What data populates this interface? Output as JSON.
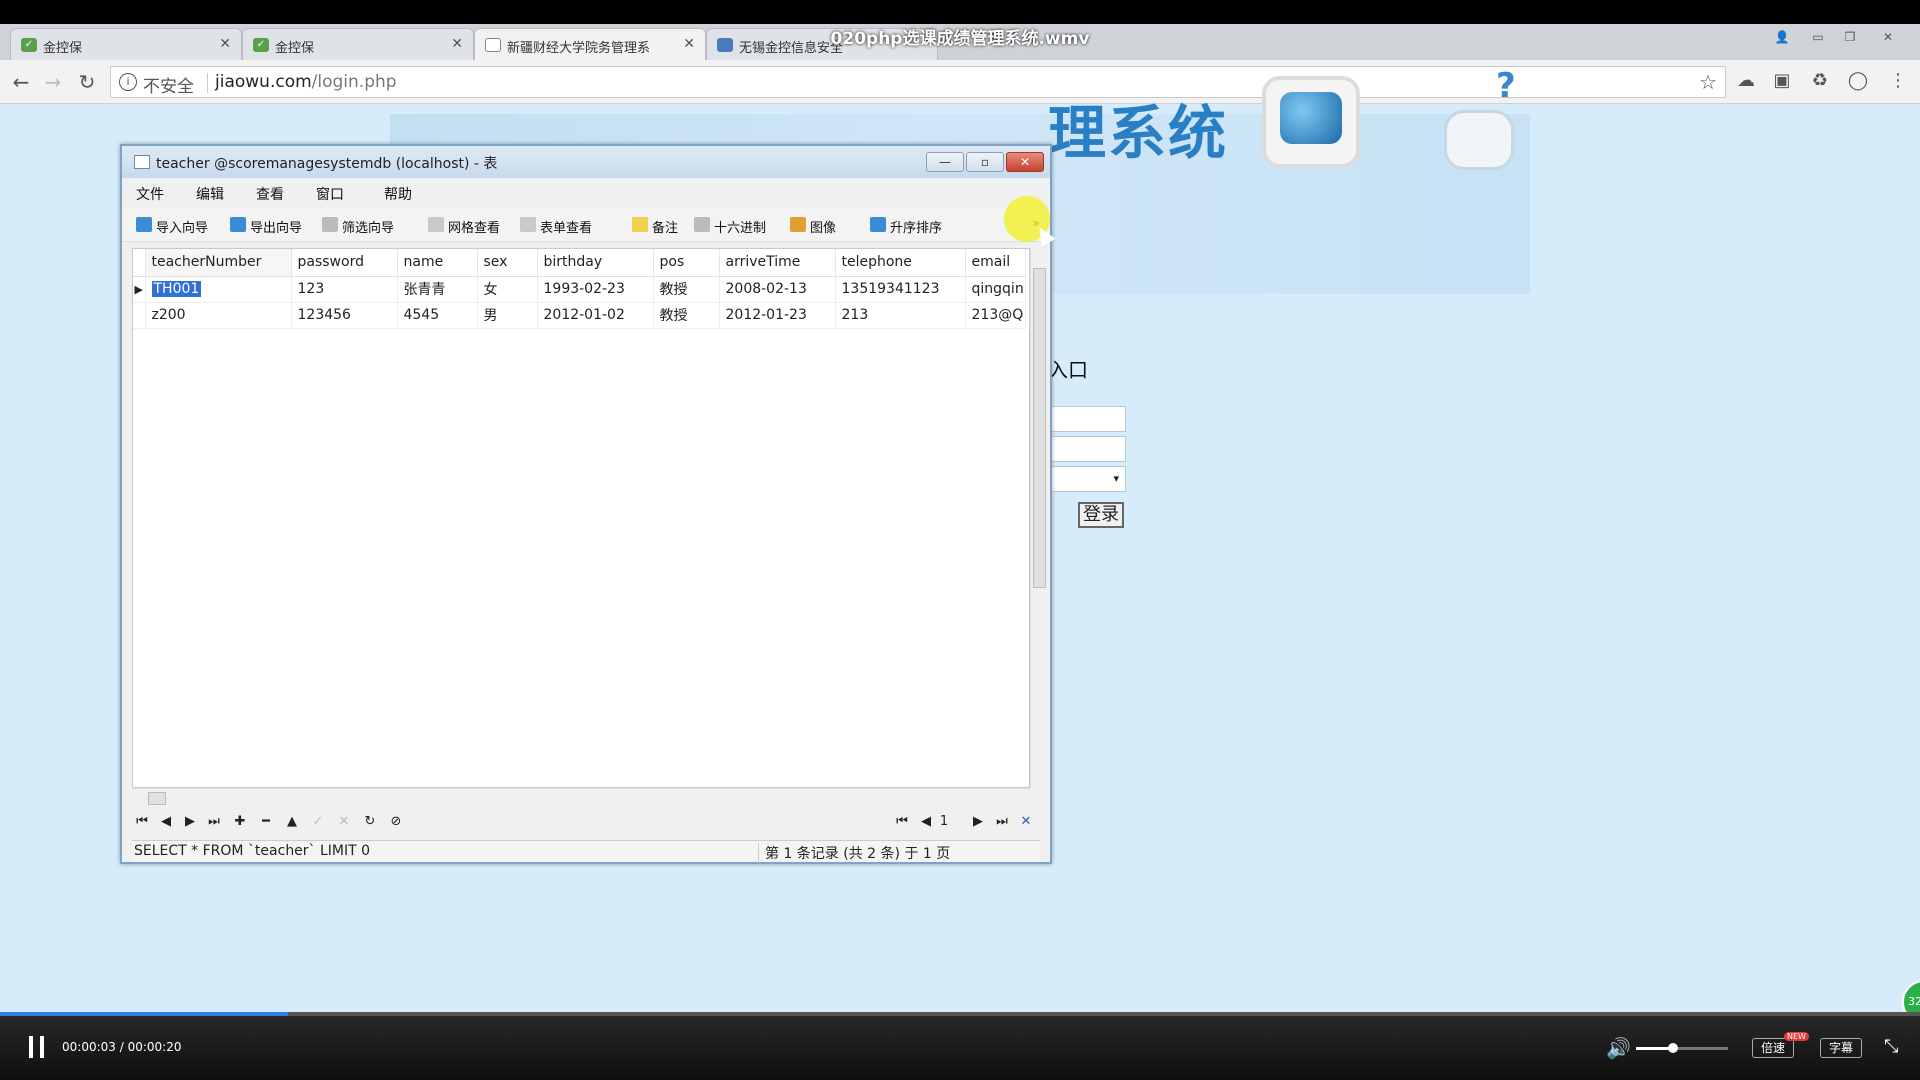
{
  "video": {
    "title": "020php选课成绩管理系统.wmv",
    "current_time": "00:00:03",
    "duration": "00:00:20",
    "time_display": "00:00:03 / 00:00:20",
    "progress_fraction": 0.15,
    "volume_fraction": 0.4,
    "speed_label": "倍速",
    "new_badge": "NEW",
    "subtitle_label": "字幕",
    "side_badge": "32"
  },
  "browser": {
    "tabs": [
      {
        "label": "金控保",
        "icon": "shield-icon",
        "active": false
      },
      {
        "label": "金控保",
        "icon": "shield-icon",
        "active": false
      },
      {
        "label": "新疆财经大学院务管理系",
        "icon": "document-icon",
        "active": true
      },
      {
        "label": "无锡金控信息安全",
        "icon": "chart-icon",
        "active": false
      }
    ],
    "security_label": "不安全",
    "url_host": "jiaowu.com",
    "url_path": "/login.php"
  },
  "page": {
    "banner_title": "理系统",
    "login_label": "入口",
    "login_button": "登录",
    "role_select": "▾"
  },
  "navicat": {
    "window_title": "teacher @scoremanagesystemdb (localhost) - 表",
    "menus": [
      "文件",
      "编辑",
      "查看",
      "窗口",
      "帮助"
    ],
    "tools": [
      {
        "label": "导入向导",
        "color": "#3b8bd8"
      },
      {
        "label": "导出向导",
        "color": "#3b8bd8"
      },
      {
        "label": "筛选向导",
        "color": "#8a8a8a"
      },
      {
        "label": "网格查看",
        "color": "#9a9a9a"
      },
      {
        "label": "表单查看",
        "color": "#9a9a9a"
      },
      {
        "label": "备注",
        "color": "#f2d04a"
      },
      {
        "label": "十六进制",
        "color": "#8a8a8a"
      },
      {
        "label": "图像",
        "color": "#e0a030"
      },
      {
        "label": "升序排序",
        "color": "#3b8bd8"
      }
    ],
    "more_label": "»",
    "columns": [
      "teacherNumber",
      "password",
      "name",
      "sex",
      "birthday",
      "pos",
      "arriveTime",
      "telephone",
      "email"
    ],
    "rows": [
      [
        "TH001",
        "123",
        "张青青",
        "女",
        "1993-02-23",
        "教授",
        "2008-02-13",
        "13519341123",
        "qingqin"
      ],
      [
        "z200",
        "123456",
        "4545",
        "男",
        "2012-01-02",
        "教授",
        "2012-01-23",
        "213",
        "213@Q"
      ]
    ],
    "page_number": "1",
    "sql": "SELECT * FROM `teacher` LIMIT 0",
    "record_info": "第 1 条记录 (共 2 条) 于 1 页"
  }
}
